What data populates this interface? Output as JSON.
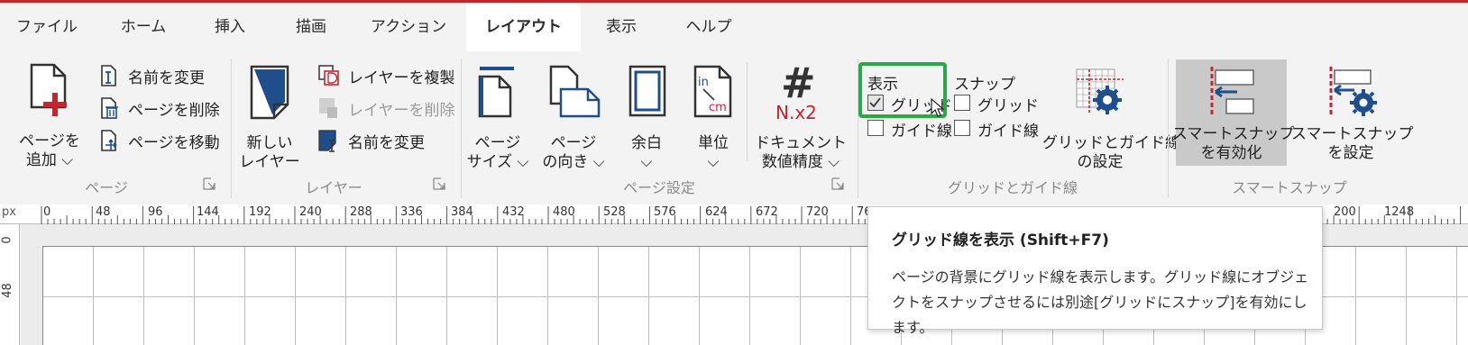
{
  "tabs": [
    "ファイル",
    "ホーム",
    "挿入",
    "描画",
    "アクション",
    "レイアウト",
    "表示",
    "ヘルプ"
  ],
  "active_tab": "レイアウト",
  "groups": {
    "page": {
      "label": "ページ",
      "add_page": [
        "ページを",
        "追加 ⌵"
      ],
      "rename": "名前を変更",
      "delete": "ページを削除",
      "move": "ページを移動"
    },
    "layer": {
      "label": "レイヤー",
      "new_layer": [
        "新しい",
        "レイヤー"
      ],
      "duplicate": "レイヤーを複製",
      "delete": "レイヤーを削除",
      "rename": "名前を変更"
    },
    "page_setup": {
      "label": "ページ設定",
      "size": [
        "ページ",
        "サイズ ⌵"
      ],
      "orientation": [
        "ページ",
        "の向き ⌵"
      ],
      "margins": [
        "余白",
        "⌵"
      ],
      "units": [
        "単位",
        "⌵"
      ],
      "precision": [
        "ドキュメント",
        "数値精度 ⌵"
      ],
      "precision_icon_text": "N.x2",
      "units_icon_in": "in",
      "units_icon_cm": "cm"
    },
    "grid": {
      "label": "グリッドとガイド線",
      "show_heading": "表示",
      "show_grid": "グリッド",
      "show_guides": "ガイド線",
      "snap_heading": "スナップ",
      "snap_grid": "グリッド",
      "snap_guides": "ガイド線",
      "settings": [
        "グリッドとガイド線",
        "の設定"
      ]
    },
    "smart_snap": {
      "label": "スマートスナップ",
      "enable": [
        "スマートスナップ",
        "を有効化"
      ],
      "settings": [
        "スマートスナップ",
        "を設定"
      ]
    }
  },
  "ruler": {
    "unit": "px",
    "h_labels": [
      "0",
      "48",
      "96",
      "144",
      "192",
      "240",
      "288",
      "336",
      "384",
      "432",
      "480",
      "528",
      "576",
      "624",
      "672",
      "720",
      "76",
      "200",
      "1248"
    ],
    "v_labels": [
      "0",
      "48"
    ]
  },
  "tooltip": {
    "title": "グリッド線を表示 (Shift+F7)",
    "body": "ページの背景にグリッド線を表示します。グリッド線にオブジェクトをスナップさせるには別途[グリッドにスナップ]を有効にします。"
  },
  "colors": {
    "accent": "#c4262e",
    "icon_blue": "#1f4e8c",
    "highlight": "#2aa84a"
  }
}
